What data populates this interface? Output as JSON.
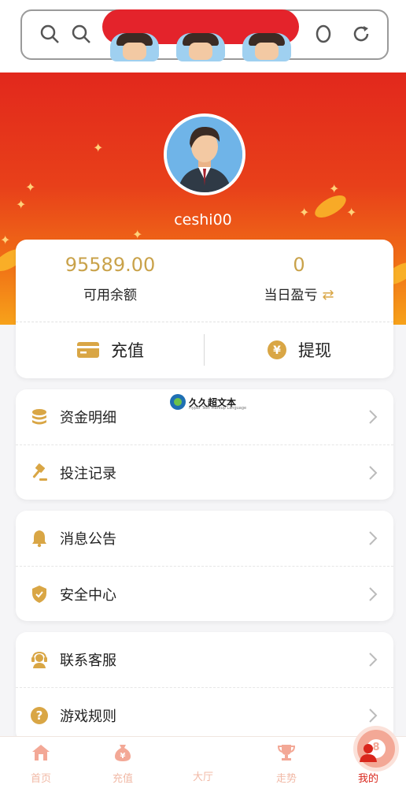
{
  "user": {
    "username": "ceshi00"
  },
  "balance": {
    "available_value": "95589.00",
    "available_label": "可用余额",
    "daily_pnl_value": "0",
    "daily_pnl_label": "当日盈亏"
  },
  "actions": {
    "recharge": "充值",
    "withdraw": "提现"
  },
  "menu_groups": [
    {
      "items": [
        {
          "label": "资金明细",
          "icon": "coins-icon"
        },
        {
          "label": "投注记录",
          "icon": "gavel-icon"
        }
      ]
    },
    {
      "items": [
        {
          "label": "消息公告",
          "icon": "bell-icon"
        },
        {
          "label": "安全中心",
          "icon": "shield-icon"
        }
      ]
    },
    {
      "items": [
        {
          "label": "联系客服",
          "icon": "headset-icon"
        },
        {
          "label": "游戏规则",
          "icon": "question-icon"
        }
      ]
    }
  ],
  "watermark": {
    "text": "久久超文本",
    "sub": "Hyper Text Markup Language"
  },
  "tabbar": {
    "tabs": [
      {
        "label": "首页",
        "icon": "home-icon"
      },
      {
        "label": "充值",
        "icon": "money-bag-icon"
      },
      {
        "label": "大厅",
        "icon": "lottery-ball-icon"
      },
      {
        "label": "走势",
        "icon": "trophy-icon"
      },
      {
        "label": "我的",
        "icon": "person-icon"
      }
    ],
    "active_index": 4
  },
  "colors": {
    "accent": "#d9261c",
    "gold": "#c9a24a",
    "hero_top": "#e2281c",
    "hero_bottom": "#f7a21a",
    "tab_inactive": "#f1b9a6"
  }
}
